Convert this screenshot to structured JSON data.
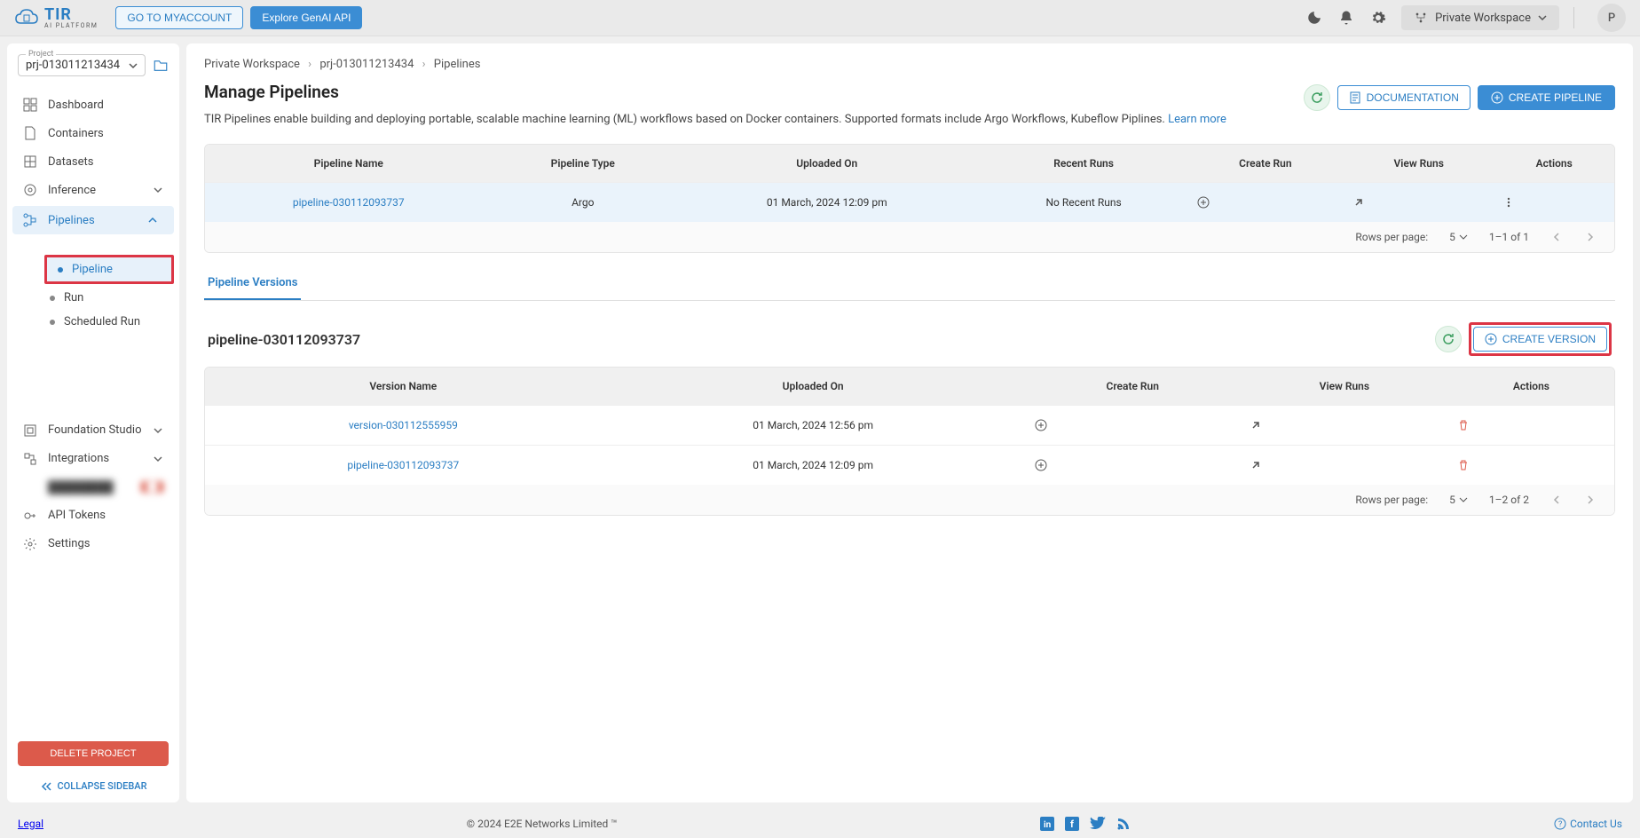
{
  "header": {
    "logo_text": "TIR",
    "logo_sub": "AI PLATFORM",
    "go_account": "GO TO MYACCOUNT",
    "explore": "Explore GenAI API",
    "workspace": "Private Workspace",
    "avatar": "P"
  },
  "sidebar": {
    "project_label": "Project",
    "project_value": "prj-013011213434",
    "items": [
      {
        "label": "Dashboard"
      },
      {
        "label": "Containers"
      },
      {
        "label": "Datasets"
      },
      {
        "label": "Inference"
      },
      {
        "label": "Pipelines"
      },
      {
        "label": "Foundation Studio"
      },
      {
        "label": "Integrations"
      },
      {
        "label": "API Tokens"
      },
      {
        "label": "Settings"
      }
    ],
    "sub_pipelines": [
      {
        "label": "Pipeline"
      },
      {
        "label": "Run"
      },
      {
        "label": "Scheduled Run"
      }
    ],
    "delete_project": "DELETE PROJECT",
    "collapse": "COLLAPSE SIDEBAR"
  },
  "breadcrumb": [
    "Private Workspace",
    "prj-013011213434",
    "Pipelines"
  ],
  "page": {
    "title": "Manage Pipelines",
    "doc_btn": "DOCUMENTATION",
    "create_btn": "CREATE PIPELINE",
    "description": "TIR Pipelines enable building and deploying portable, scalable machine learning (ML) workflows based on Docker containers. Supported formats include Argo Workflows, Kubeflow Piplines. ",
    "learn_more": "Learn more"
  },
  "pipelines_table": {
    "headers": [
      "Pipeline Name",
      "Pipeline Type",
      "Uploaded On",
      "Recent Runs",
      "Create Run",
      "View Runs",
      "Actions"
    ],
    "rows": [
      {
        "name": "pipeline-030112093737",
        "type": "Argo",
        "uploaded": "01 March, 2024 12:09 pm",
        "recent": "No Recent Runs"
      }
    ],
    "rows_per_page_label": "Rows per page:",
    "rows_per_page": "5",
    "range": "1–1 of 1"
  },
  "versions": {
    "tab": "Pipeline Versions",
    "title": "pipeline-030112093737",
    "create_btn": "CREATE VERSION",
    "headers": [
      "Version Name",
      "Uploaded On",
      "Create Run",
      "View Runs",
      "Actions"
    ],
    "rows": [
      {
        "name": "version-030112555959",
        "uploaded": "01 March, 2024 12:56 pm"
      },
      {
        "name": "pipeline-030112093737",
        "uploaded": "01 March, 2024 12:09 pm"
      }
    ],
    "rows_per_page_label": "Rows per page:",
    "rows_per_page": "5",
    "range": "1–2 of 2"
  },
  "footer": {
    "legal": "Legal",
    "copyright": "© 2024 E2E Networks Limited ™",
    "contact": "Contact Us"
  }
}
